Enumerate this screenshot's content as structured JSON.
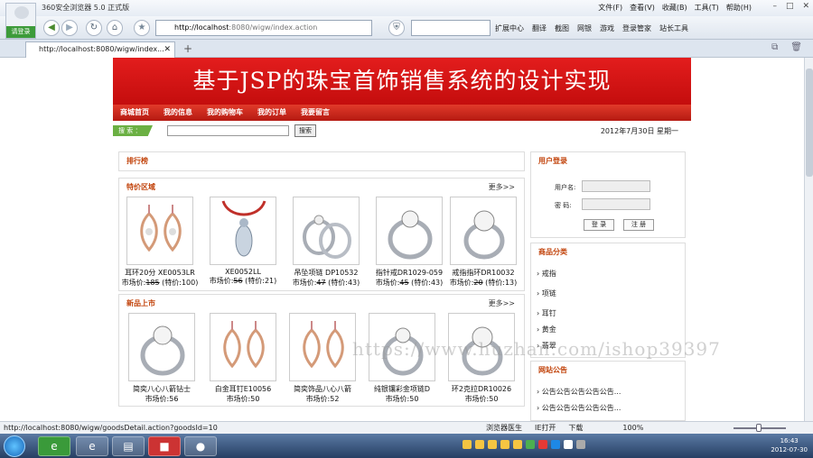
{
  "browser": {
    "title": "360安全浏览器 5.0 正式版",
    "login": "请登录",
    "menu": [
      "文件(F)",
      "查看(V)",
      "收藏(B)",
      "工具(T)",
      "帮助(H)"
    ],
    "address_host": "http://localhost",
    "address_rest": ":8080/wigw/index.action",
    "toolbar": [
      "扩展中心",
      "翻译",
      "截图",
      "网银",
      "游戏",
      "登录管家",
      "站长工具"
    ],
    "tab_label": "http://localhost:8080/wigw/index..."
  },
  "site": {
    "banner": "基于JSP的珠宝首饰销售系统的设计实现",
    "nav": [
      "商城首页",
      "我的信息",
      "我的购物车",
      "我的订单",
      "我要留言"
    ],
    "search_tag": "搜 索 ：",
    "search_button": "搜索",
    "date": "2012年7月30日  星期一",
    "ranking_title": "排行榜",
    "special_title": "特价区域",
    "new_title": "新品上市",
    "more": "更多>>",
    "special_products": [
      {
        "name": "耳环20分  XE0053LR",
        "price_prefix": "市场价:",
        "market": "185",
        "special": "(特价:100)"
      },
      {
        "name": "XE0052LL",
        "price_prefix": "市场价:",
        "market": "56",
        "special": "(特价:21)"
      },
      {
        "name": "吊坠项链  DP10532",
        "price_prefix": "市场价:",
        "market": "47",
        "special": "(特价:43)"
      },
      {
        "name": "指针戒DR1029-059",
        "price_prefix": "市场价:",
        "market": "45",
        "special": "(特价:43)"
      },
      {
        "name": "戒指指环DR10032",
        "price_prefix": "市场价:",
        "market": "20",
        "special": "(特价:13)"
      }
    ],
    "new_products": [
      {
        "name": "简奕八心八箭钻士",
        "price": "市场价:56"
      },
      {
        "name": "白金耳钉E10056",
        "price": "市场价:50"
      },
      {
        "name": "简奕饰品八心八箭",
        "price": "市场价:52"
      },
      {
        "name": "纯银镶彩金项链D",
        "price": "市场价:50"
      },
      {
        "name": "环2克拉DR10026",
        "price": "市场价:50"
      }
    ],
    "user_login": {
      "title": "用户登录",
      "username_label": "用户名:",
      "password_label": "密  码:",
      "login_btn": "登 录",
      "register_btn": "注 册"
    },
    "categories": {
      "title": "商品分类",
      "items": [
        "戒指",
        "项链",
        "耳钉",
        "黄金",
        "翡翠"
      ]
    },
    "notices": {
      "title": "网站公告",
      "items": [
        "公告公告公告公告公告...",
        "公告公告公告公告公告..."
      ]
    },
    "watermark": "https://www.huzhan.com/ishop39397"
  },
  "statusbar": {
    "url": "http://localhost:8080/wigw/goodsDetail.action?goodsId=10",
    "items": [
      "浏览器医生",
      "IE打开",
      "下载",
      "100%"
    ]
  },
  "taskbar": {
    "time": "16:43",
    "date": "2012-07-30"
  }
}
